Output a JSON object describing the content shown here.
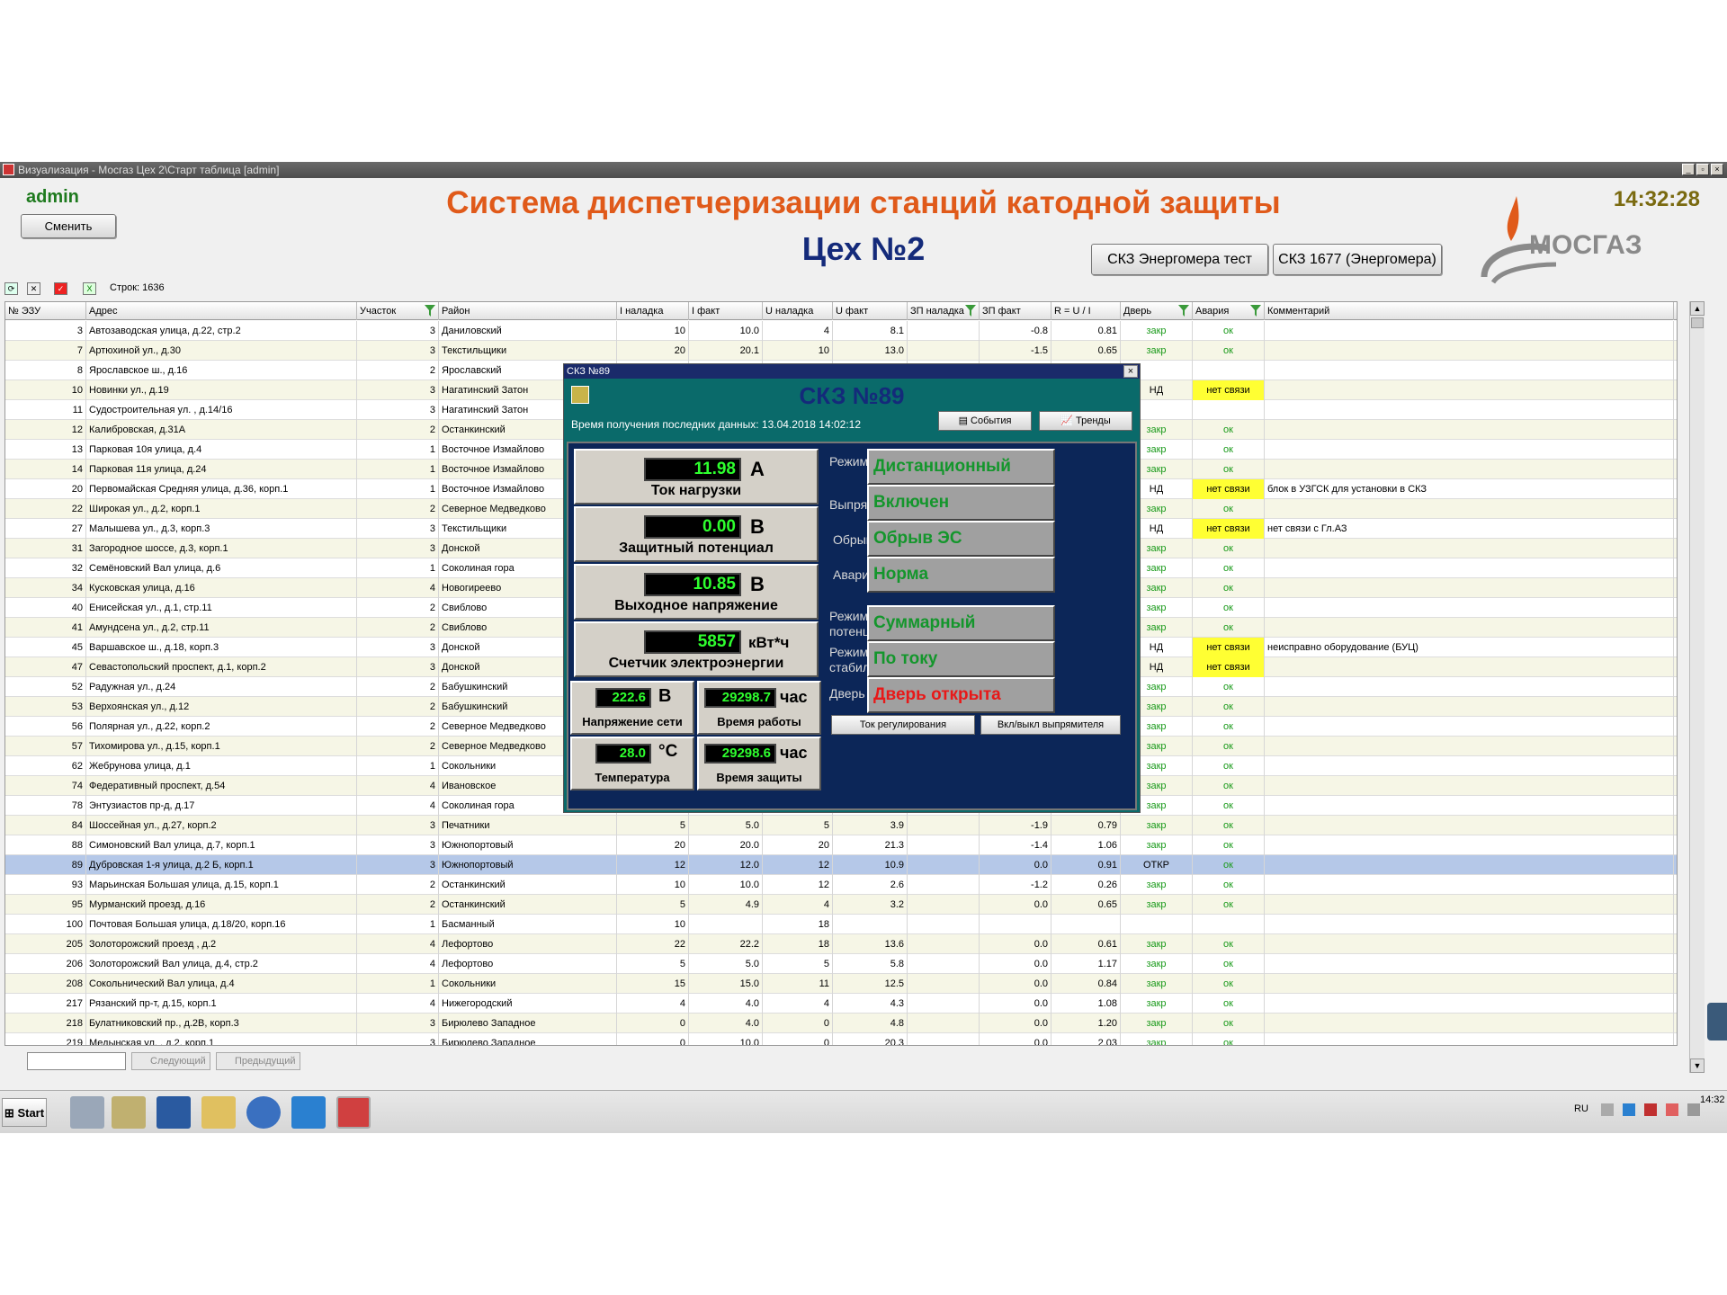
{
  "window": {
    "title": "Визуализация - Мосгаз Цех 2\\Старт таблица [admin]"
  },
  "header": {
    "user": "admin",
    "change_button": "Сменить",
    "title": "Система диспетчеризации станций катодной защиты",
    "subtitle": "Цех №2",
    "clock": "14:32:28",
    "btn_test": "СКЗ Энергомера тест",
    "btn_1677": "СКЗ 1677 (Энергомера)",
    "logo_text": "МОСГАЗ"
  },
  "toolbar": {
    "rows": "Строк: 1636"
  },
  "table": {
    "columns": [
      "№ ЭЗУ",
      "Адрес",
      "Участок",
      "Район",
      "I наладка",
      "I факт",
      "U наладка",
      "U факт",
      "ЗП наладка",
      "ЗП факт",
      "R = U / I",
      "Дверь",
      "Авария",
      "Комментарий"
    ],
    "rows": [
      [
        "3",
        "Автозаводская улица, д.22, стр.2",
        "3",
        "Даниловский",
        "10",
        "10.0",
        "4",
        "8.1",
        "",
        "-0.8",
        "0.81",
        "закр",
        "ок",
        ""
      ],
      [
        "7",
        "Артюхиной ул., д.30",
        "3",
        "Текстильщики",
        "20",
        "20.1",
        "10",
        "13.0",
        "",
        "-1.5",
        "0.65",
        "закр",
        "ок",
        ""
      ],
      [
        "8",
        "Ярославское ш., д.16",
        "2",
        "Ярославский",
        "",
        "",
        "",
        "",
        "",
        "",
        "",
        "",
        "",
        ""
      ],
      [
        "10",
        "Новинки ул., д.19",
        "3",
        "Нагатинский Затон",
        "",
        "",
        "",
        "",
        "",
        "",
        "",
        "НД",
        "нет связи",
        ""
      ],
      [
        "11",
        "Судостроительная ул. , д.14/16",
        "3",
        "Нагатинский Затон",
        "",
        "",
        "",
        "",
        "",
        "",
        "",
        "",
        "",
        ""
      ],
      [
        "12",
        "Калибровская, д.31А",
        "2",
        "Останкинский",
        "",
        "",
        "",
        "",
        "",
        "",
        "",
        "закр",
        "ок",
        ""
      ],
      [
        "13",
        "Парковая 10я улица, д.4",
        "1",
        "Восточное Измайлово",
        "",
        "",
        "",
        "",
        "",
        "",
        "",
        "закр",
        "ок",
        ""
      ],
      [
        "14",
        "Парковая 11я улица, д.24",
        "1",
        "Восточное Измайлово",
        "",
        "",
        "",
        "",
        "",
        "",
        "",
        "закр",
        "ок",
        ""
      ],
      [
        "20",
        "Первомайская Средняя улица, д.36, корп.1",
        "1",
        "Восточное Измайлово",
        "",
        "",
        "",
        "",
        "",
        "",
        "",
        "НД",
        "нет связи",
        "блок в УЗГСК для установки в СКЗ"
      ],
      [
        "22",
        "Широкая ул., д.2, корп.1",
        "2",
        "Северное Медведково",
        "",
        "",
        "",
        "",
        "",
        "",
        "",
        "закр",
        "ок",
        ""
      ],
      [
        "27",
        "Малышева ул., д.3, корп.3",
        "3",
        "Текстильщики",
        "",
        "",
        "",
        "",
        "",
        "",
        "",
        "НД",
        "нет связи",
        "нет связи с Гл.АЗ"
      ],
      [
        "31",
        "Загородное шоссе, д.3, корп.1",
        "3",
        "Донской",
        "",
        "",
        "",
        "",
        "",
        "",
        "",
        "закр",
        "ок",
        ""
      ],
      [
        "32",
        "Семёновский Вал улица, д.6",
        "1",
        "Соколиная гора",
        "",
        "",
        "",
        "",
        "",
        "",
        "",
        "закр",
        "ок",
        ""
      ],
      [
        "34",
        "Кусковская улица, д.16",
        "4",
        "Новогиреево",
        "",
        "",
        "",
        "",
        "",
        "",
        "",
        "закр",
        "ок",
        ""
      ],
      [
        "40",
        "Енисейская ул., д.1, стр.11",
        "2",
        "Свиблово",
        "",
        "",
        "",
        "",
        "",
        "",
        "",
        "закр",
        "ок",
        ""
      ],
      [
        "41",
        "Амундсена ул., д.2, стр.11",
        "2",
        "Свиблово",
        "",
        "",
        "",
        "",
        "",
        "",
        "",
        "закр",
        "ок",
        ""
      ],
      [
        "45",
        "Варшавское ш., д.18, корп.3",
        "3",
        "Донской",
        "",
        "",
        "",
        "",
        "",
        "",
        "",
        "НД",
        "нет связи",
        "неисправно оборудование (БУЦ)"
      ],
      [
        "47",
        "Севастопольский проспект, д.1, корп.2",
        "3",
        "Донской",
        "",
        "",
        "",
        "",
        "",
        "",
        "",
        "НД",
        "нет связи",
        ""
      ],
      [
        "52",
        "Радужная ул., д.24",
        "2",
        "Бабушкинский",
        "",
        "",
        "",
        "",
        "",
        "",
        "",
        "закр",
        "ок",
        ""
      ],
      [
        "53",
        "Верхоянская ул., д.12",
        "2",
        "Бабушкинский",
        "",
        "",
        "",
        "",
        "",
        "",
        "",
        "закр",
        "ок",
        ""
      ],
      [
        "56",
        "Полярная ул., д.22, корп.2",
        "2",
        "Северное Медведково",
        "",
        "",
        "",
        "",
        "",
        "",
        "",
        "закр",
        "ок",
        ""
      ],
      [
        "57",
        "Тихомирова ул., д.15, корп.1",
        "2",
        "Северное Медведково",
        "",
        "",
        "",
        "",
        "",
        "",
        "",
        "закр",
        "ок",
        ""
      ],
      [
        "62",
        "Жебрунова улица, д.1",
        "1",
        "Сокольники",
        "",
        "",
        "",
        "",
        "",
        "",
        "",
        "закр",
        "ок",
        ""
      ],
      [
        "74",
        "Федеративный проспект, д.54",
        "4",
        "Ивановское",
        "",
        "",
        "",
        "",
        "",
        "",
        "",
        "закр",
        "ок",
        ""
      ],
      [
        "78",
        "Энтузиастов пр-д, д.17",
        "4",
        "Соколиная гора",
        "",
        "",
        "",
        "",
        "",
        "",
        "",
        "закр",
        "ок",
        ""
      ],
      [
        "84",
        "Шоссейная ул., д.27, корп.2",
        "3",
        "Печатники",
        "5",
        "5.0",
        "5",
        "3.9",
        "",
        "-1.9",
        "0.79",
        "закр",
        "ок",
        ""
      ],
      [
        "88",
        "Симоновский Вал улица, д.7, корп.1",
        "3",
        "Южнопортовый",
        "20",
        "20.0",
        "20",
        "21.3",
        "",
        "-1.4",
        "1.06",
        "закр",
        "ок",
        ""
      ],
      [
        "89",
        "Дубровская 1-я улица, д.2 Б, корп.1",
        "3",
        "Южнопортовый",
        "12",
        "12.0",
        "12",
        "10.9",
        "",
        "0.0",
        "0.91",
        "ОТКР",
        "ок",
        ""
      ],
      [
        "93",
        "Марьинская Большая улица, д.15, корп.1",
        "2",
        "Останкинский",
        "10",
        "10.0",
        "12",
        "2.6",
        "",
        "-1.2",
        "0.26",
        "закр",
        "ок",
        ""
      ],
      [
        "95",
        "Мурманский проезд, д.16",
        "2",
        "Останкинский",
        "5",
        "4.9",
        "4",
        "3.2",
        "",
        "0.0",
        "0.65",
        "закр",
        "ок",
        ""
      ],
      [
        "100",
        "Почтовая Большая улица, д.18/20, корп.16",
        "1",
        "Басманный",
        "10",
        "",
        "18",
        "",
        "",
        "",
        "",
        "",
        "",
        ""
      ],
      [
        "205",
        "Золоторожский проезд , д.2",
        "4",
        "Лефортово",
        "22",
        "22.2",
        "18",
        "13.6",
        "",
        "0.0",
        "0.61",
        "закр",
        "ок",
        ""
      ],
      [
        "206",
        "Золоторожский Вал улица, д.4, стр.2",
        "4",
        "Лефортово",
        "5",
        "5.0",
        "5",
        "5.8",
        "",
        "0.0",
        "1.17",
        "закр",
        "ок",
        ""
      ],
      [
        "208",
        "Сокольнический Вал улица, д.4",
        "1",
        "Сокольники",
        "15",
        "15.0",
        "11",
        "12.5",
        "",
        "0.0",
        "0.84",
        "закр",
        "ок",
        ""
      ],
      [
        "217",
        "Рязанский пр-т, д.15, корп.1",
        "4",
        "Нижегородский",
        "4",
        "4.0",
        "4",
        "4.3",
        "",
        "0.0",
        "1.08",
        "закр",
        "ок",
        ""
      ],
      [
        "218",
        "Булатниковский пр., д.2В, корп.3",
        "3",
        "Бирюлево Западное",
        "0",
        "4.0",
        "0",
        "4.8",
        "",
        "0.0",
        "1.20",
        "закр",
        "ок",
        ""
      ],
      [
        "219",
        "Медынская ул. , д.2, корп.1",
        "3",
        "Бирюлево Западное",
        "0",
        "10.0",
        "0",
        "20.3",
        "",
        "0.0",
        "2.03",
        "закр",
        "ок",
        ""
      ]
    ]
  },
  "navigation": {
    "next": "Следующий",
    "prev": "Предыдущий"
  },
  "popup": {
    "window_title": "СКЗ №89",
    "heading": "СКЗ №89",
    "last_data": "Время получения последних данных:  13.04.2018 14:02:12",
    "events_btn": "События",
    "trends_btn": "Тренды",
    "current": {
      "value": "11.98",
      "unit": "А",
      "label": "Ток нагрузки"
    },
    "potential": {
      "value": "0.00",
      "unit": "В",
      "label": "Защитный потенциал"
    },
    "voltage": {
      "value": "10.85",
      "unit": "В",
      "label": "Выходное напряжение"
    },
    "energy": {
      "value": "5857",
      "unit": "кВт*ч",
      "label": "Счетчик электроэнергии"
    },
    "mains": {
      "value": "222.6",
      "unit": "В",
      "label": "Напряжение сети"
    },
    "worktime": {
      "value": "29298.7",
      "unit": "час",
      "label": "Время работы"
    },
    "temp": {
      "value": "28.0",
      "unit": "°С",
      "label": "Температура"
    },
    "protect": {
      "value": "29298.6",
      "unit": "час",
      "label": "Время защиты"
    },
    "modes": [
      {
        "label": "Режим управления",
        "value": "Дистанционный"
      },
      {
        "label": "Выпрямитель",
        "value": "Включен"
      },
      {
        "label": "Обрыв ЭС",
        "value": "Обрыв ЭС"
      },
      {
        "label": "Авария",
        "value": "Норма"
      },
      {
        "label": "Режим потенциала",
        "value": "Суммарный"
      },
      {
        "label": "Режим стабилизации",
        "value": "По току"
      },
      {
        "label": "Дверь",
        "value": "Дверь открыта"
      }
    ],
    "btn_current": "Ток регулирования",
    "btn_rectifier": "Вкл/выкл выпрямителя"
  },
  "taskbar": {
    "start": "Start",
    "lang": "RU",
    "time": "14:32"
  },
  "colors": {
    "title_orange": "#e05a1a",
    "subtitle_blue": "#142a7a",
    "ok_green": "#1a9a1a",
    "warn_yellow": "#ffff33",
    "lcd_green": "#2eff2e",
    "status_red": "#e81818"
  }
}
